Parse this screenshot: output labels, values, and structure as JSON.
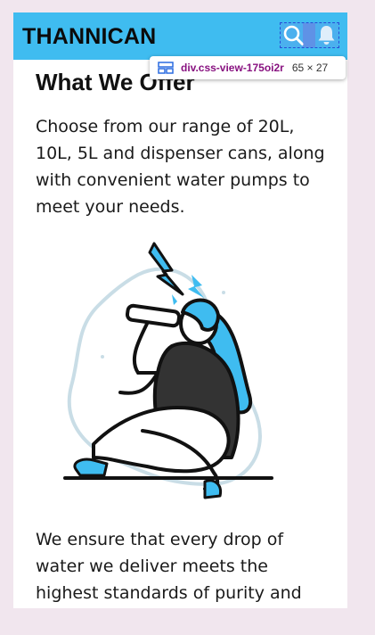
{
  "header": {
    "brand": "THANNICAN",
    "search_icon": "search-icon",
    "notification_icon": "bell-icon",
    "background_color": "#3fbcf0"
  },
  "devtools_tooltip": {
    "selector": "div.css-view-175oi2r",
    "size": "65 × 27"
  },
  "main": {
    "heading": "What We Offer",
    "intro": "Choose from our range of 20L, 10L, 5L and dispenser cans, along with convenient water pumps to meet your needs.",
    "illustration": "person-drinking-water-illustration",
    "quality_text": "We ensure that every drop of water we deliver meets the highest standards of purity and"
  }
}
